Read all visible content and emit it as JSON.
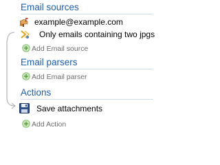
{
  "sections": {
    "email_sources": {
      "title": "Email sources",
      "items": [
        {
          "label": "example@example.com",
          "icon": "mailbox-icon"
        },
        {
          "label": "Only emails containing two jpgs",
          "icon": "filter-icon"
        }
      ],
      "add_label": "Add Email source"
    },
    "email_parsers": {
      "title": "Email parsers",
      "add_label": "Add Email parser"
    },
    "actions": {
      "title": "Actions",
      "items": [
        {
          "label": "Save attachments",
          "icon": "floppy-disk-icon"
        }
      ],
      "add_label": "Add Action"
    }
  },
  "colors": {
    "section_title": "#1f5ea9",
    "add_icon": "#8fc27a",
    "add_text": "#6e6e6e",
    "connector": "#b0b0b0"
  }
}
